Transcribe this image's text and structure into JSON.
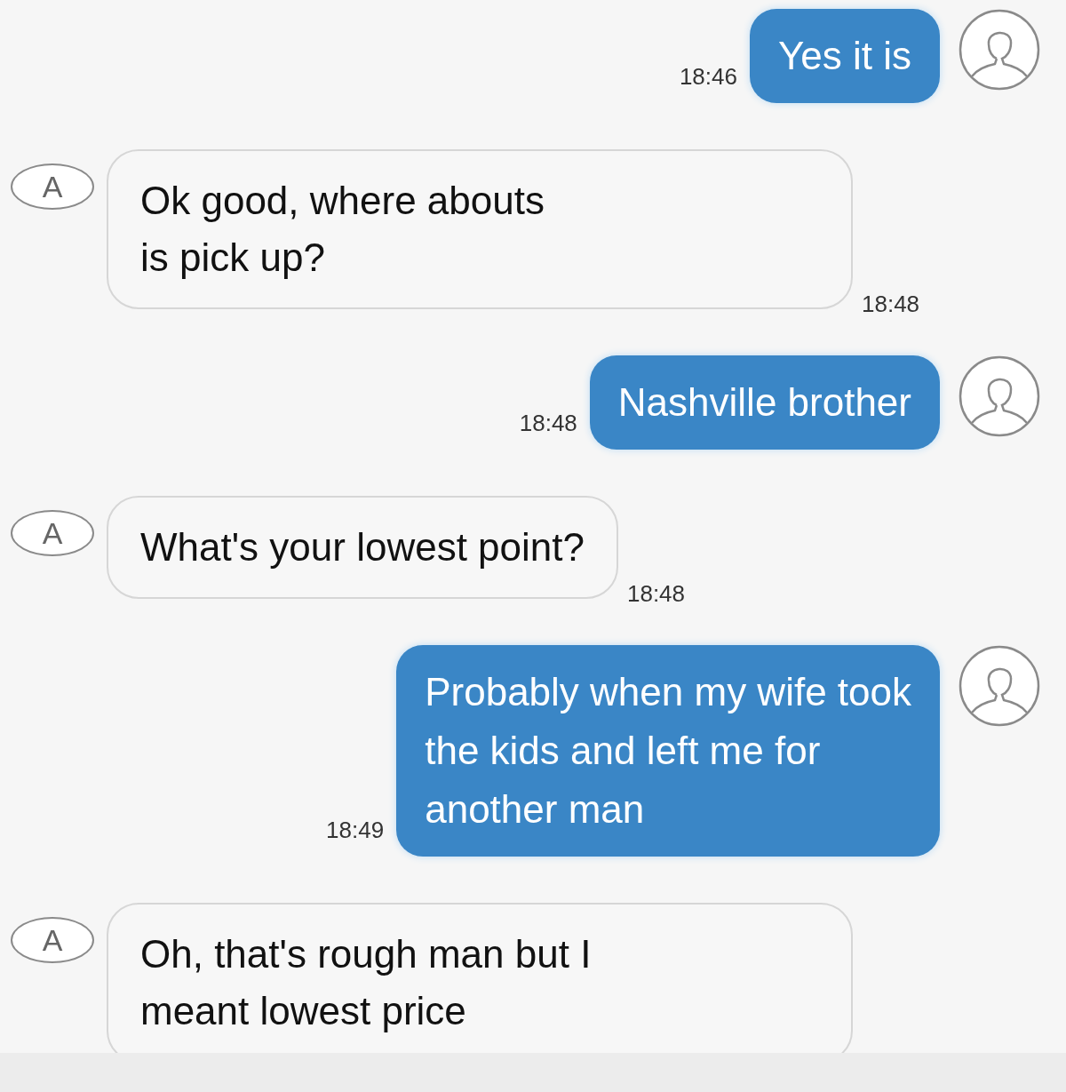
{
  "messages": [
    {
      "kind": "sent",
      "lines": [
        "Yes it is"
      ],
      "time": "18:46"
    },
    {
      "kind": "received",
      "avatar": "A",
      "lines": [
        "Ok good, where abouts",
        "is pick up?"
      ],
      "time": "18:48"
    },
    {
      "kind": "sent",
      "lines": [
        "Nashville brother"
      ],
      "time": "18:48"
    },
    {
      "kind": "received",
      "avatar": "A",
      "lines": [
        "What's your lowest point?"
      ],
      "time": "18:48"
    },
    {
      "kind": "sent",
      "lines": [
        "Probably when my wife took",
        "the kids and left me for",
        "another man"
      ],
      "time": "18:49"
    },
    {
      "kind": "received",
      "avatar": "A",
      "lines": [
        "Oh, that's rough man but I",
        "meant lowest price"
      ]
    }
  ]
}
